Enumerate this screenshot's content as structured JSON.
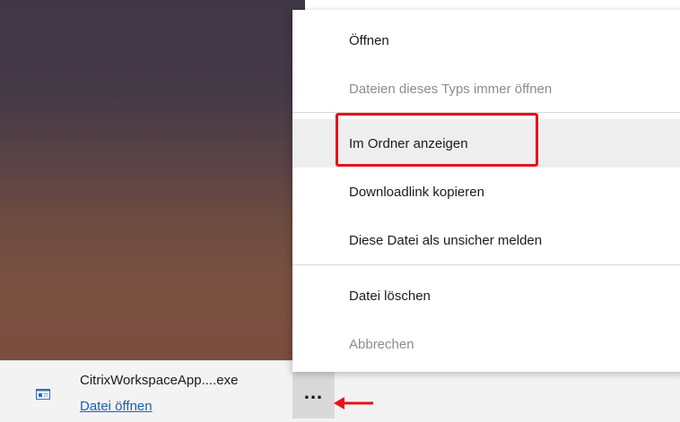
{
  "download": {
    "file_name": "CitrixWorkspaceApp....exe",
    "open_link": "Datei öffnen",
    "more_label": "..."
  },
  "menu": {
    "items": [
      {
        "label": "Öffnen",
        "enabled": true
      },
      {
        "label": "Dateien dieses Typs immer öffnen",
        "enabled": false
      },
      {
        "label": "Im Ordner anzeigen",
        "enabled": true,
        "highlighted": true
      },
      {
        "label": "Downloadlink kopieren",
        "enabled": true
      },
      {
        "label": "Diese Datei als unsicher melden",
        "enabled": true
      },
      {
        "label": "Datei löschen",
        "enabled": true
      },
      {
        "label": "Abbrechen",
        "enabled": false
      }
    ]
  },
  "annotations": {
    "highlight_color": "#e8101c"
  },
  "colors": {
    "link": "#1a5fb4",
    "menu_hover": "#eeeeee",
    "disabled_text": "#8c8c8c"
  }
}
